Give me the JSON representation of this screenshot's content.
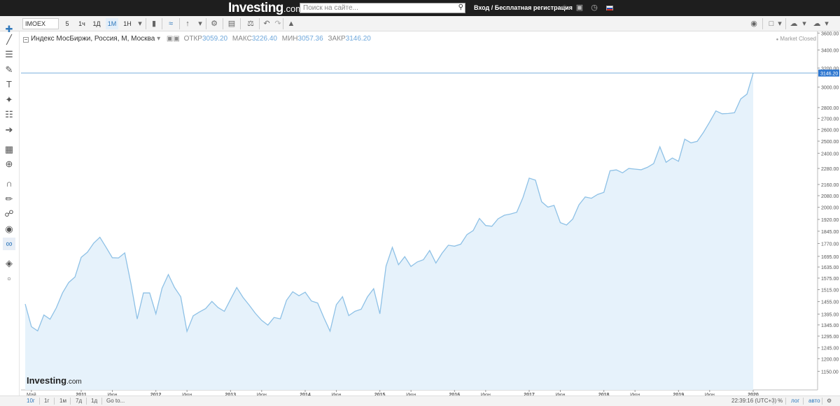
{
  "header": {
    "logo_main": "Investing",
    "logo_suffix": ".com",
    "search_placeholder": "Поиск на сайте...",
    "login_text": "Вход / Бесплатная регистрация"
  },
  "toolbar": {
    "symbol": "IMOEX",
    "intervals": [
      "5",
      "1ч",
      "1Д",
      "1М",
      "1Н"
    ],
    "active_interval": "1М"
  },
  "legend": {
    "title": "Индекс МосБиржи, Россия, М, Москва",
    "open_label": "ОТКР",
    "open_value": "3059.20",
    "high_label": "МАКС",
    "high_value": "3226.40",
    "low_label": "МИН",
    "low_value": "3057.36",
    "close_label": "ЗАКР",
    "close_value": "3146.20"
  },
  "market_status": "Market Closed",
  "watermark": {
    "main": "Investing",
    "suffix": ".com"
  },
  "bottom_bar": {
    "ranges": [
      "10г",
      "1г",
      "1м",
      "7д",
      "1д"
    ],
    "active_range": "10г",
    "goto": "Go to...",
    "time": "22:39:16 (UTC+3)",
    "percent": "%",
    "log": "лог",
    "auto": "авто"
  },
  "colors": {
    "line": "#8ec1e6",
    "fill": "#e6f2fb",
    "price_tag": "#2e77d0",
    "header_bg": "#1e1e1e"
  },
  "chart_data": {
    "type": "area",
    "symbol": "IMOEX",
    "last_price_label": "3146.20",
    "y_ticks": [
      "3600.00",
      "3400.00",
      "3200.00",
      "3000.00",
      "2800.00",
      "2700.00",
      "2600.00",
      "2500.00",
      "2400.00",
      "2280.00",
      "2160.00",
      "2080.00",
      "2000.00",
      "1920.00",
      "1845.00",
      "1770.00",
      "1695.00",
      "1635.00",
      "1575.00",
      "1515.00",
      "1455.00",
      "1395.00",
      "1345.00",
      "1295.00",
      "1245.00",
      "1200.00",
      "1150.00"
    ],
    "x_ticks": [
      "Май",
      "2011",
      "Июн",
      "2012",
      "Июн",
      "2013",
      "Июн",
      "2014",
      "Июн",
      "2015",
      "Июн",
      "2016",
      "Июн",
      "2017",
      "Июн",
      "2018",
      "Июн",
      "2019",
      "Июн",
      "2020"
    ],
    "x_tick_dates": [
      2010.333,
      2011.0,
      2011.417,
      2012.0,
      2012.417,
      2013.0,
      2013.417,
      2014.0,
      2014.417,
      2015.0,
      2015.417,
      2016.0,
      2016.417,
      2017.0,
      2017.417,
      2018.0,
      2018.417,
      2019.0,
      2019.417,
      2020.0
    ],
    "x_range": [
      2010.25,
      2020.0
    ],
    "y_range": [
      1080,
      3620
    ],
    "series": [
      {
        "values": [
          [
            2010.25,
            1443
          ],
          [
            2010.333,
            1337
          ],
          [
            2010.417,
            1318
          ],
          [
            2010.5,
            1391
          ],
          [
            2010.583,
            1371
          ],
          [
            2010.667,
            1425
          ],
          [
            2010.75,
            1498
          ],
          [
            2010.833,
            1552
          ],
          [
            2010.917,
            1581
          ],
          [
            2011.0,
            1689
          ],
          [
            2011.083,
            1719
          ],
          [
            2011.167,
            1772
          ],
          [
            2011.25,
            1808
          ],
          [
            2011.333,
            1748
          ],
          [
            2011.417,
            1687
          ],
          [
            2011.5,
            1686
          ],
          [
            2011.583,
            1715
          ],
          [
            2011.667,
            1545
          ],
          [
            2011.75,
            1372
          ],
          [
            2011.833,
            1498
          ],
          [
            2011.917,
            1498
          ],
          [
            2012.0,
            1396
          ],
          [
            2012.083,
            1522
          ],
          [
            2012.167,
            1594
          ],
          [
            2012.25,
            1526
          ],
          [
            2012.333,
            1479
          ],
          [
            2012.417,
            1316
          ],
          [
            2012.5,
            1387
          ],
          [
            2012.583,
            1405
          ],
          [
            2012.667,
            1421
          ],
          [
            2012.75,
            1456
          ],
          [
            2012.833,
            1426
          ],
          [
            2012.917,
            1408
          ],
          [
            2013.0,
            1466
          ],
          [
            2013.083,
            1526
          ],
          [
            2013.167,
            1476
          ],
          [
            2013.25,
            1438
          ],
          [
            2013.333,
            1398
          ],
          [
            2013.417,
            1366
          ],
          [
            2013.5,
            1344
          ],
          [
            2013.583,
            1379
          ],
          [
            2013.667,
            1373
          ],
          [
            2013.75,
            1461
          ],
          [
            2013.833,
            1504
          ],
          [
            2013.917,
            1484
          ],
          [
            2014.0,
            1502
          ],
          [
            2014.083,
            1458
          ],
          [
            2014.167,
            1448
          ],
          [
            2014.25,
            1378
          ],
          [
            2014.333,
            1317
          ],
          [
            2014.417,
            1440
          ],
          [
            2014.5,
            1479
          ],
          [
            2014.583,
            1388
          ],
          [
            2014.667,
            1408
          ],
          [
            2014.75,
            1418
          ],
          [
            2014.833,
            1478
          ],
          [
            2014.917,
            1520
          ],
          [
            2015.0,
            1396
          ],
          [
            2015.083,
            1640
          ],
          [
            2015.167,
            1747
          ],
          [
            2015.25,
            1648
          ],
          [
            2015.333,
            1693
          ],
          [
            2015.417,
            1638
          ],
          [
            2015.5,
            1663
          ],
          [
            2015.583,
            1676
          ],
          [
            2015.667,
            1729
          ],
          [
            2015.75,
            1657
          ],
          [
            2015.833,
            1713
          ],
          [
            2015.917,
            1760
          ],
          [
            2016.0,
            1754
          ],
          [
            2016.083,
            1766
          ],
          [
            2016.167,
            1824
          ],
          [
            2016.25,
            1849
          ],
          [
            2016.333,
            1926
          ],
          [
            2016.417,
            1881
          ],
          [
            2016.5,
            1876
          ],
          [
            2016.583,
            1924
          ],
          [
            2016.667,
            1947
          ],
          [
            2016.75,
            1955
          ],
          [
            2016.833,
            1967
          ],
          [
            2016.917,
            2067
          ],
          [
            2017.0,
            2207
          ],
          [
            2017.083,
            2192
          ],
          [
            2017.167,
            2038
          ],
          [
            2017.25,
            2001
          ],
          [
            2017.333,
            2013
          ],
          [
            2017.417,
            1899
          ],
          [
            2017.5,
            1884
          ],
          [
            2017.583,
            1922
          ],
          [
            2017.667,
            2017
          ],
          [
            2017.75,
            2071
          ],
          [
            2017.833,
            2062
          ],
          [
            2017.917,
            2089
          ],
          [
            2018.0,
            2104
          ],
          [
            2018.083,
            2263
          ],
          [
            2018.167,
            2269
          ],
          [
            2018.25,
            2247
          ],
          [
            2018.333,
            2280
          ],
          [
            2018.417,
            2275
          ],
          [
            2018.5,
            2270
          ],
          [
            2018.583,
            2289
          ],
          [
            2018.667,
            2318
          ],
          [
            2018.75,
            2453
          ],
          [
            2018.833,
            2328
          ],
          [
            2018.917,
            2362
          ],
          [
            2019.0,
            2336
          ],
          [
            2019.083,
            2517
          ],
          [
            2019.167,
            2486
          ],
          [
            2019.25,
            2498
          ],
          [
            2019.333,
            2575
          ],
          [
            2019.417,
            2667
          ],
          [
            2019.5,
            2769
          ],
          [
            2019.583,
            2742
          ],
          [
            2019.667,
            2745
          ],
          [
            2019.75,
            2752
          ],
          [
            2019.833,
            2883
          ],
          [
            2019.917,
            2930
          ],
          [
            2020.0,
            3146
          ]
        ]
      }
    ]
  }
}
